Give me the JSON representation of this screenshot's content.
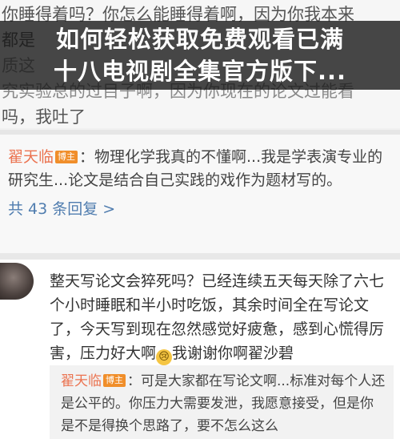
{
  "background_text": {
    "line1": "你睡得着吗？你怎么能睡得着啊，因为你我本来",
    "line2": "都是",
    "line3": "质这",
    "line4": "究实验总的过目子啊，因为你现在的论文过能看",
    "line5": "吗，我吐了"
  },
  "headline": {
    "line1": "如何轻松获取免费观看已满",
    "line2": "十八电视剧全集官方版下..."
  },
  "comment1": {
    "author": "翟天临",
    "badge": "博主",
    "text": "：物理化学我真的不懂啊...我是学表演专业的研究生...论文是结合自己实践的戏作为题材写的。",
    "more_link": "共 43 条回复 >"
  },
  "comment2": {
    "text_before": "整天写论文会猝死吗？已经连续五天每天除了六七个小时睡眠和半小时吃饭，其余时间全在写论文了，今天写到现在忽然感觉好疲惫，感到心慌得厉害，压力好大啊",
    "emoji": "😢",
    "text_after": "我谢谢你啊翟沙碧"
  },
  "quote": {
    "author": "翟天临",
    "badge": "博主",
    "text": "：可是大家都在写论文啊...标准对每个人还是公平的。你压力大需要发泄，我愿意接受，但是你是不是得换个思路了，要不怎么这么"
  }
}
